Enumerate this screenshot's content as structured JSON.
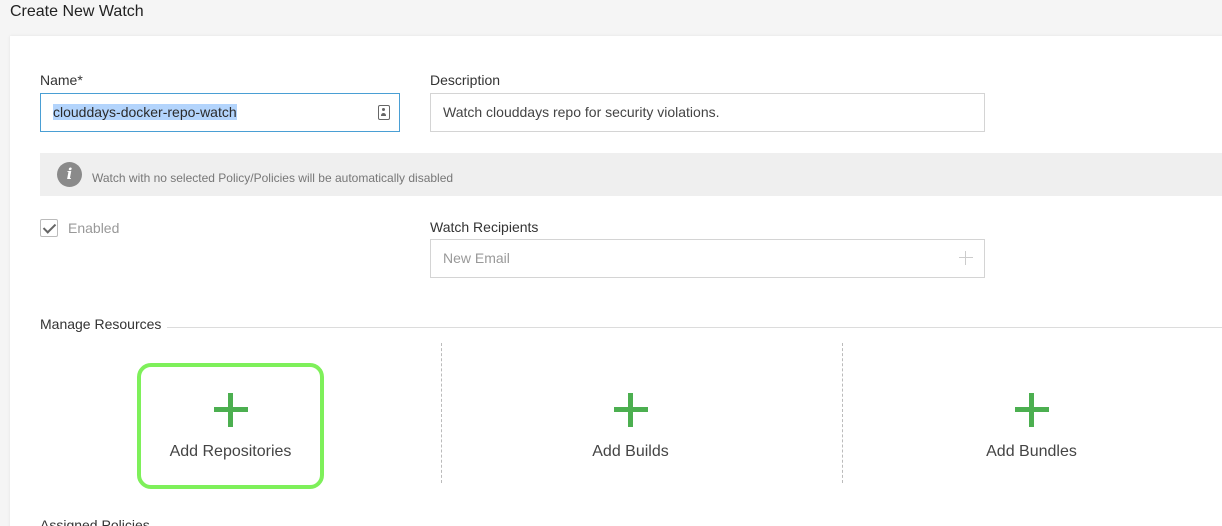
{
  "page": {
    "title": "Create New Watch"
  },
  "form": {
    "name_label": "Name*",
    "name_value": "clouddays-docker-repo-watch",
    "description_label": "Description",
    "description_value": "Watch clouddays repo for security violations.",
    "info_message": "Watch with no selected Policy/Policies will be automatically disabled",
    "enabled_label": "Enabled",
    "enabled_checked": true,
    "recipients_label": "Watch Recipients",
    "recipients_placeholder": "New Email"
  },
  "resources": {
    "title": "Manage Resources",
    "cards": [
      {
        "label": "Add Repositories"
      },
      {
        "label": "Add Builds"
      },
      {
        "label": "Add Bundles"
      }
    ]
  },
  "policies": {
    "title": "Assigned Policies"
  },
  "colors": {
    "accent_green": "#4caf50",
    "highlight": "#7ef05a",
    "focus_border": "#4a9fd4"
  }
}
